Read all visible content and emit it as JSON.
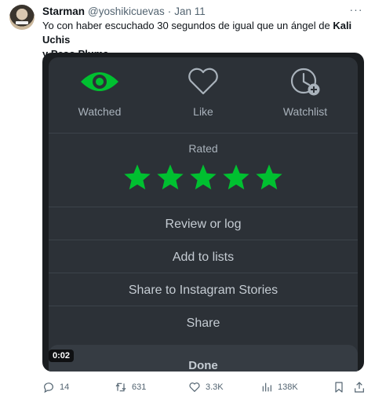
{
  "tweet": {
    "author_name": "Starman",
    "handle": "@yoshikicuevas",
    "separator": "·",
    "date": "Jan 11",
    "more_icon": "more-horizontal-icon",
    "text_plain": "Yo con haber escuchado 30 segundos de igual que un ángel de ",
    "text_bold_1": "Kali Uchis",
    "text_bold_2": "y Peso Pluma"
  },
  "media": {
    "actions": [
      {
        "label": "Watched",
        "icon": "eye-icon",
        "color": "#00c030"
      },
      {
        "label": "Like",
        "icon": "heart-icon"
      },
      {
        "label": "Watchlist",
        "icon": "clock-plus-icon"
      }
    ],
    "rated_label": "Rated",
    "stars": {
      "value": 5,
      "max": 5,
      "color": "#00c030"
    },
    "options": [
      "Review or log",
      "Add to lists",
      "Share to Instagram Stories",
      "Share"
    ],
    "done_label": "Done",
    "timestamp": "0:02"
  },
  "footer": {
    "replies": "14",
    "reposts": "631",
    "likes": "3.3K",
    "views": "138K",
    "bookmark_icon": "bookmark-icon",
    "share_icon": "share-icon"
  },
  "colors": {
    "accent_green": "#00c030",
    "text": "#0f1419",
    "muted": "#536471"
  }
}
